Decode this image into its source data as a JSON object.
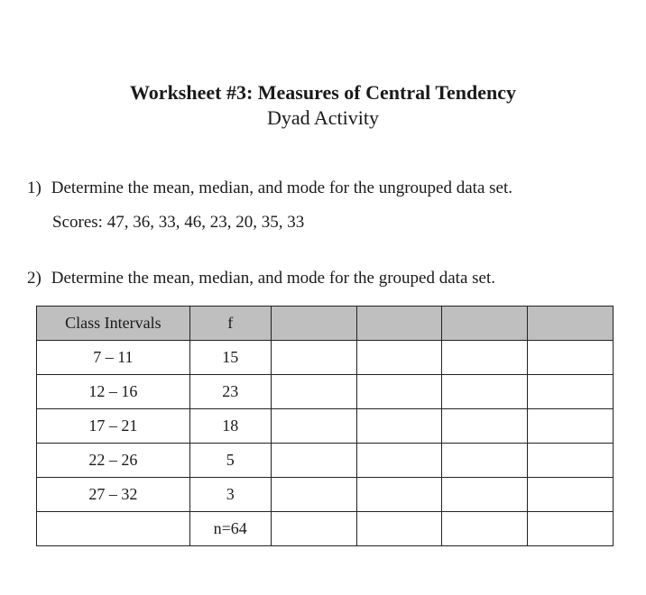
{
  "header": {
    "title": "Worksheet #3: Measures of Central Tendency",
    "subtitle": "Dyad Activity"
  },
  "q1": {
    "number": "1)",
    "text": "Determine the mean, median, and mode for the ungrouped data set.",
    "scores_label": "Scores:",
    "scores": "47, 36, 33, 46, 23, 20, 35, 33"
  },
  "q2": {
    "number": "2)",
    "text": "Determine the mean, median, and mode for the grouped data set."
  },
  "table": {
    "headers": {
      "interval": "Class Intervals",
      "f": "f"
    },
    "rows": [
      {
        "interval": "7 – 11",
        "f": "15"
      },
      {
        "interval": "12 – 16",
        "f": "23"
      },
      {
        "interval": "17 – 21",
        "f": "18"
      },
      {
        "interval": "22 – 26",
        "f": "5"
      },
      {
        "interval": "27 – 32",
        "f": "3"
      }
    ],
    "total": {
      "interval": "",
      "f": "n=64"
    }
  }
}
